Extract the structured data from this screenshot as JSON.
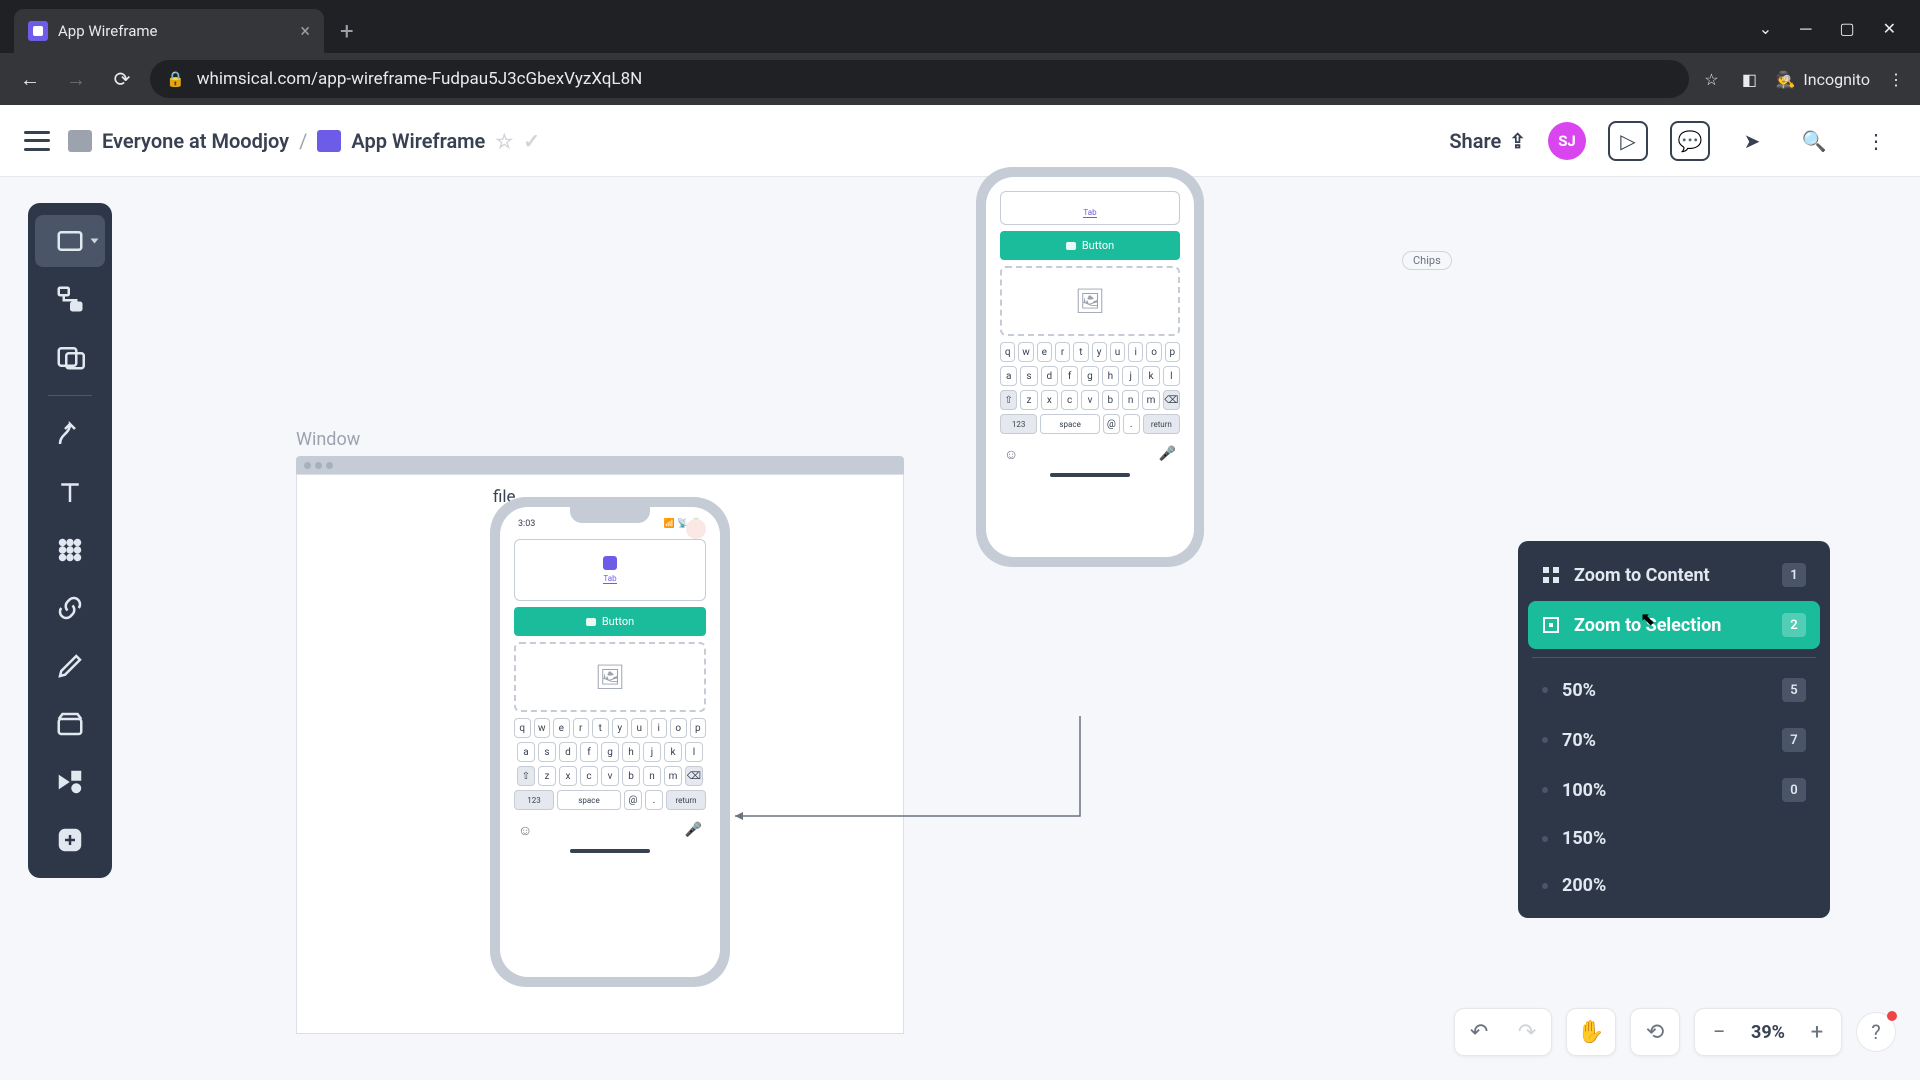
{
  "browser": {
    "tab_title": "App Wireframe",
    "url": "whimsical.com/app-wireframe-Fudpau5J3cGbexVyzXqL8N",
    "incognito_label": "Incognito"
  },
  "breadcrumb": {
    "org": "Everyone at Moodjoy",
    "doc": "App Wireframe"
  },
  "header": {
    "share": "Share",
    "avatar": "SJ"
  },
  "canvas": {
    "window_label": "Window",
    "file_label": "file",
    "button_label": "Button",
    "chips_label": "Chips",
    "time": "3:03",
    "keyboard_rows": [
      [
        "q",
        "w",
        "e",
        "r",
        "t",
        "y",
        "u",
        "i",
        "o",
        "p"
      ],
      [
        "a",
        "s",
        "d",
        "f",
        "g",
        "h",
        "j",
        "k",
        "l"
      ],
      [
        "⇧",
        "z",
        "x",
        "c",
        "v",
        "b",
        "n",
        "m",
        "⌫"
      ]
    ],
    "kb_bottom": {
      "num": "123",
      "space": "space",
      "at": "@",
      "dot": ".",
      "ret": "return"
    }
  },
  "zoom_menu": {
    "items": [
      {
        "label": "Zoom to Content",
        "key": "1",
        "icon": "grid"
      },
      {
        "label": "Zoom to Selection",
        "key": "2",
        "icon": "target",
        "active": true
      }
    ],
    "levels": [
      {
        "label": "50%",
        "key": "5"
      },
      {
        "label": "70%",
        "key": "7"
      },
      {
        "label": "100%",
        "key": "0"
      },
      {
        "label": "150%",
        "key": ""
      },
      {
        "label": "200%",
        "key": ""
      }
    ]
  },
  "bottom": {
    "zoom_pct": "39%"
  }
}
